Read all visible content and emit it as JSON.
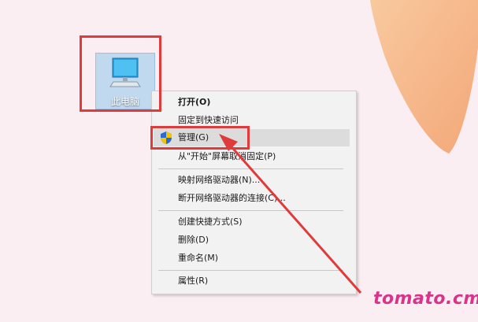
{
  "desktop": {
    "icon": {
      "label": "此电脑",
      "icon": "monitor-icon"
    }
  },
  "context_menu": {
    "items": [
      {
        "label": "打开(O)"
      },
      {
        "label": "固定到快速访问"
      },
      {
        "label": "管理(G)",
        "icon": "uac-shield-icon"
      },
      {
        "label": "从\"开始\"屏幕取消固定(P)"
      },
      {
        "label": "映射网络驱动器(N)..."
      },
      {
        "label": "断开网络驱动器的连接(C)..."
      },
      {
        "label": "创建快捷方式(S)"
      },
      {
        "label": "删除(D)"
      },
      {
        "label": "重命名(M)"
      },
      {
        "label": "属性(R)"
      }
    ]
  },
  "annotation": {
    "color": "#e03a3a"
  },
  "watermark": {
    "text": "tomato.cm",
    "color": "#d9348a"
  }
}
